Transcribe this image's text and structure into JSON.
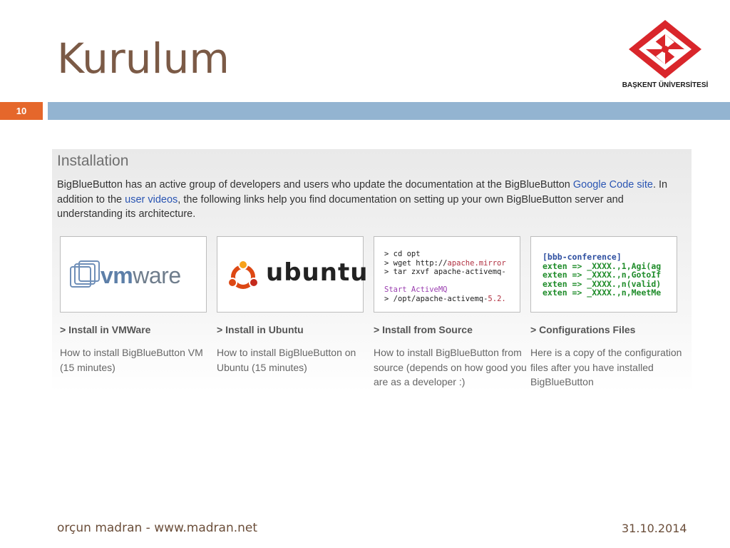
{
  "slide": {
    "title": "Kurulum",
    "number": "10",
    "logo_text": "BAŞKENT ÜNİVERSİTESİ",
    "footer_left": "orçun madran - www.madran.net",
    "footer_right": "31.10.2014"
  },
  "panel": {
    "title": "Installation",
    "desc_1": "BigBlueButton has an active group of developers and users who update the documentation at the BigBlueButton ",
    "link_google_code": "Google Code site",
    "desc_2": ". In addition to the ",
    "link_user_videos": "user videos",
    "desc_3": ", the following links help you find documentation on setting up your own BigBlueButton server and understanding its architecture."
  },
  "cards": [
    {
      "logo": "vmware-logo",
      "logo_text_bold": "vm",
      "logo_text_rest": "ware",
      "title": "> Install in VMWare",
      "desc": "How to install BigBlueButton VM (15 minutes)"
    },
    {
      "logo": "ubuntu-logo",
      "logo_text": "ubuntu",
      "title": "> Install in Ubuntu",
      "desc": "How to install BigBlueButton on Ubuntu (15 minutes)"
    },
    {
      "code_lines": [
        "> cd opt",
        "> wget http://",
        "apache.mirror",
        "> tar zxvf apache-activemq-",
        "Start ActiveMQ",
        "> /opt/",
        "apache-activemq-",
        "5.2."
      ],
      "title": "> Install from Source",
      "desc": "How to install BigBlueButton from source (depends on how good you are as a developer :)"
    },
    {
      "code_lines": [
        "[bbb-conference]",
        "exten => _XXXX.,1,Agi(ag",
        "exten => _XXXX.,n,GotoIf",
        "exten => _XXXX.,n(valid)",
        "exten => _XXXX.,n,MeetMe"
      ],
      "title": "> Configurations Files",
      "desc": "Here is a copy of the configuration files after you have installed BigBlueButton"
    }
  ],
  "colors": {
    "title": "#7b5a46",
    "slide_number_bg": "#e5672b",
    "header_bar": "#93b4d1",
    "link": "#2a55b3",
    "logo_red": "#d9262b"
  }
}
